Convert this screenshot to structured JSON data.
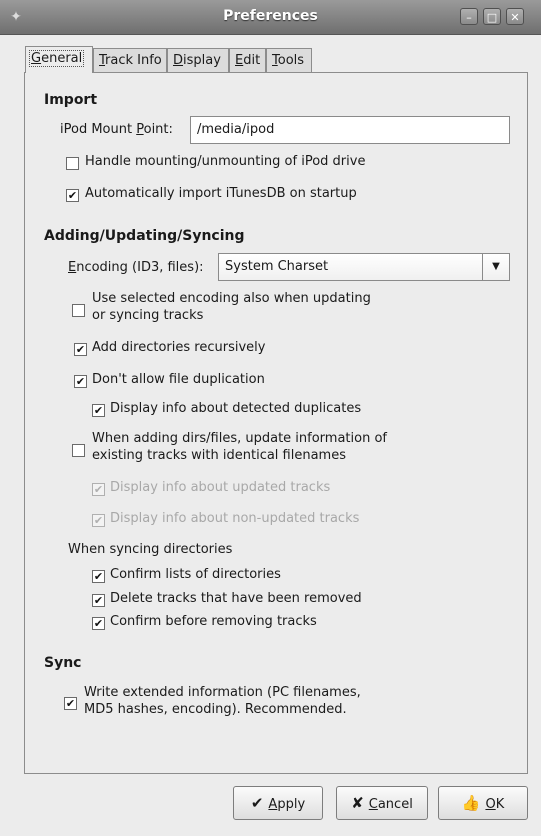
{
  "window": {
    "title": "Preferences",
    "icons": {
      "app": "app-icon",
      "minimize": "minimize-icon",
      "maximize": "maximize-icon",
      "close": "close-icon"
    }
  },
  "tabs": [
    {
      "mn": "G",
      "rest": "eneral",
      "active": true
    },
    {
      "mn": "T",
      "rest": "rack Info",
      "active": false
    },
    {
      "mn": "D",
      "rest": "isplay",
      "active": false
    },
    {
      "mn": "E",
      "rest": "dit",
      "active": false
    },
    {
      "mn": "T",
      "rest": "ools",
      "active": false
    }
  ],
  "import": {
    "heading": "Import",
    "mount_label_pre": "iPod Mount ",
    "mount_label_mn": "P",
    "mount_label_post": "oint:",
    "mount_value": "/media/ipod",
    "handle_mounting": {
      "label": "Handle mounting/unmounting of iPod drive",
      "checked": false
    },
    "auto_import": {
      "label": "Automatically import iTunesDB on startup",
      "checked": true
    }
  },
  "adding": {
    "heading": "Adding/Updating/Syncing",
    "encoding_label_mn": "E",
    "encoding_label_rest": "ncoding (ID3, files):",
    "encoding_value": "System Charset",
    "use_selected": {
      "line1": "Use selected encoding also when updating",
      "line2": "or syncing tracks",
      "checked": false
    },
    "add_recursive": {
      "label": "Add directories recursively",
      "checked": true
    },
    "no_duplication": {
      "label": "Don't allow file duplication",
      "checked": true
    },
    "display_duplicates": {
      "label": "Display info about detected duplicates",
      "checked": true
    },
    "update_existing": {
      "line1": "When adding dirs/files, update information of",
      "line2": "existing tracks with identical filenames",
      "checked": false
    },
    "display_updated": {
      "label": "Display info about updated tracks",
      "checked": true
    },
    "display_non_updated": {
      "label": "Display info about non-updated tracks",
      "checked": true
    },
    "syncing_label": "When syncing directories",
    "confirm_lists": {
      "label": "Confirm lists of directories",
      "checked": true
    },
    "delete_removed": {
      "label": "Delete tracks that have been removed",
      "checked": true
    },
    "confirm_removing": {
      "label": "Confirm before removing tracks",
      "checked": true
    }
  },
  "sync": {
    "heading": "Sync",
    "write_extended": {
      "line1": "Write extended information (PC filenames,",
      "line2": "MD5 hashes, encoding). Recommended.",
      "checked": true
    }
  },
  "buttons": {
    "apply": {
      "mn": "A",
      "rest": "pply",
      "icon": "checkmark-icon"
    },
    "cancel": {
      "mn": "C",
      "rest": "ancel",
      "icon": "x-icon"
    },
    "ok": {
      "mn": "O",
      "rest": "K",
      "icon": "thumbs-up-icon"
    }
  }
}
